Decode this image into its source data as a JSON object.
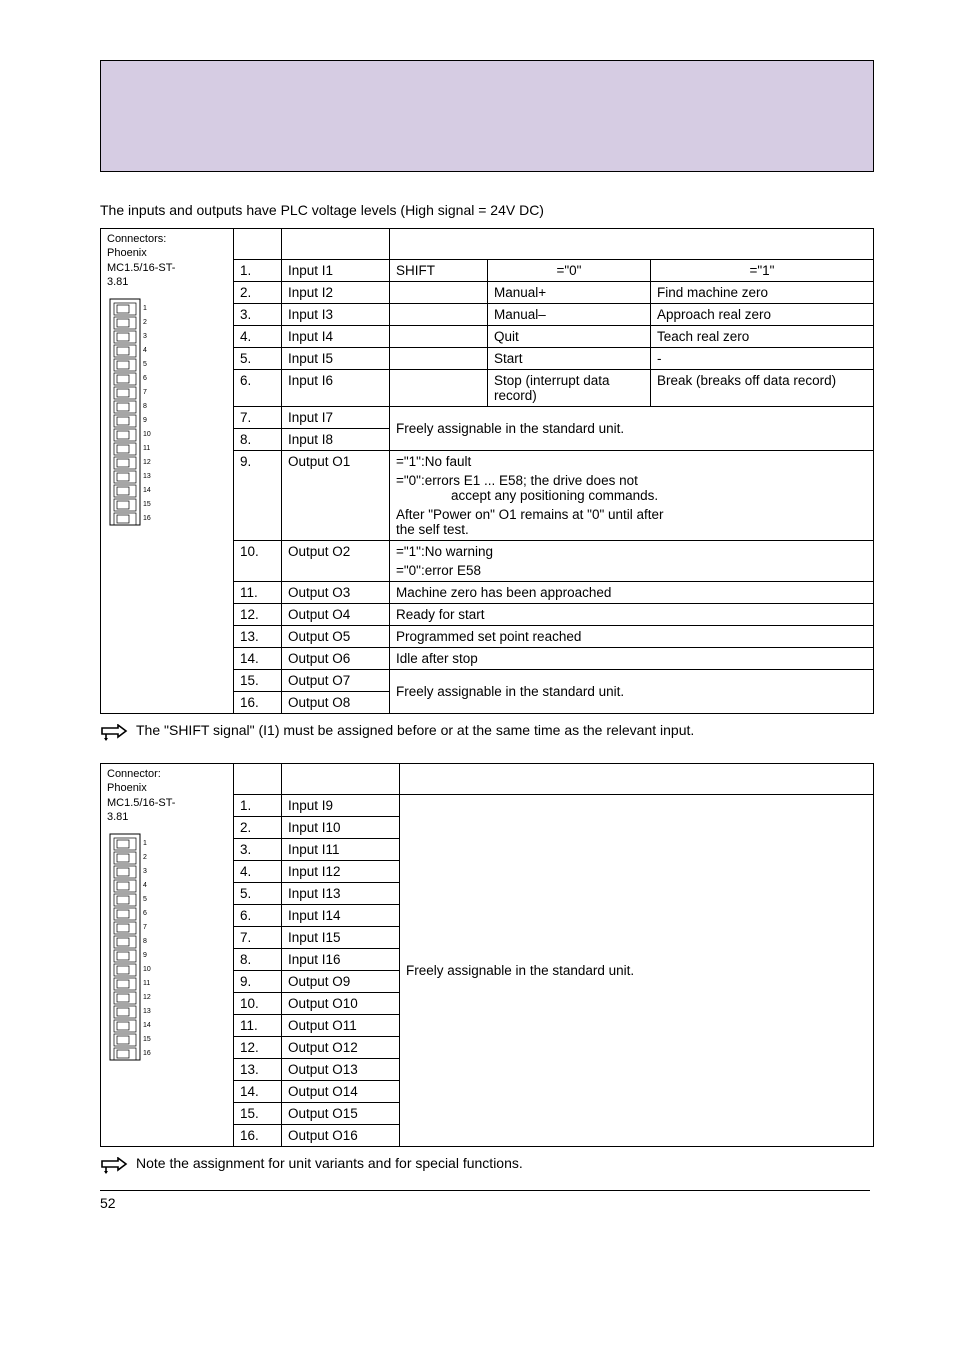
{
  "intro": "The inputs and outputs have PLC voltage levels (High signal = 24V DC)",
  "connector_label": {
    "line1": "Connectors:",
    "line2": "Phoenix",
    "line3": "MC1.5/16-ST-",
    "line4": "3.81"
  },
  "x10": {
    "shift_header": {
      "col1": "SHIFT",
      "col2": "=\"0\"",
      "col3": "=\"1\""
    },
    "rows": [
      {
        "n": "1.",
        "sig": "Input I1"
      },
      {
        "n": "2.",
        "sig": "Input I2",
        "c2": "Manual+",
        "c3": "Find machine zero"
      },
      {
        "n": "3.",
        "sig": "Input I3",
        "c2": "Manual–",
        "c3": "Approach real zero"
      },
      {
        "n": "4.",
        "sig": "Input I4",
        "c2": "Quit",
        "c3": "Teach real zero"
      },
      {
        "n": "5.",
        "sig": "Input I5",
        "c2": "Start",
        "c3": "-"
      },
      {
        "n": "6.",
        "sig": "Input I6",
        "c2": "Stop (interrupt data record)",
        "c3": "Break (breaks off data record)"
      },
      {
        "n": "7.",
        "sig": "Input I7"
      },
      {
        "n": "8.",
        "sig": "Input I8"
      },
      {
        "n": "9.",
        "sig": "Output O1"
      },
      {
        "n": "10.",
        "sig": "Output O2"
      },
      {
        "n": "11.",
        "sig": "Output O3",
        "m": "Machine zero has been approached"
      },
      {
        "n": "12.",
        "sig": "Output O4",
        "m": "Ready for start"
      },
      {
        "n": "13.",
        "sig": "Output O5",
        "m": "Programmed set point reached"
      },
      {
        "n": "14.",
        "sig": "Output O6",
        "m": "Idle after stop"
      },
      {
        "n": "15.",
        "sig": "Output O7"
      },
      {
        "n": "16.",
        "sig": "Output O8"
      }
    ],
    "free_assign": "Freely assignable in the standard unit.",
    "o1": {
      "l1": "=\"1\":No fault",
      "l2a": "=\"0\":errors E1 ... E58; the drive does not",
      "l2b": "accept any positioning commands.",
      "l3a": "After \"Power on\" O1 remains at \"0\" until after",
      "l3b": "the self test."
    },
    "o2": {
      "l1": "=\"1\":No warning",
      "l2": "=\"0\":error    E58"
    }
  },
  "note1": "The \"SHIFT signal\" (I1) must be assigned before or at the same time as the relevant input.",
  "connector2_label": {
    "line1": "Connector:",
    "line2": "Phoenix",
    "line3": "MC1.5/16-ST-",
    "line4": "3.81"
  },
  "x11": {
    "rows": [
      {
        "n": "1.",
        "sig": "Input I9"
      },
      {
        "n": "2.",
        "sig": "Input I10"
      },
      {
        "n": "3.",
        "sig": "Input I11"
      },
      {
        "n": "4.",
        "sig": "Input I12"
      },
      {
        "n": "5.",
        "sig": "Input I13"
      },
      {
        "n": "6.",
        "sig": "Input I14"
      },
      {
        "n": "7.",
        "sig": "Input I15"
      },
      {
        "n": "8.",
        "sig": "Input I16"
      },
      {
        "n": "9.",
        "sig": "Output O9"
      },
      {
        "n": "10.",
        "sig": "Output O10"
      },
      {
        "n": "11.",
        "sig": "Output O11"
      },
      {
        "n": "12.",
        "sig": "Output O12"
      },
      {
        "n": "13.",
        "sig": "Output O13"
      },
      {
        "n": "14.",
        "sig": "Output O14"
      },
      {
        "n": "15.",
        "sig": "Output O15"
      },
      {
        "n": "16.",
        "sig": "Output O16"
      }
    ],
    "free_assign": "Freely assignable in the standard unit."
  },
  "note2": "Note the assignment for unit variants and for special functions.",
  "pagenum": "52"
}
